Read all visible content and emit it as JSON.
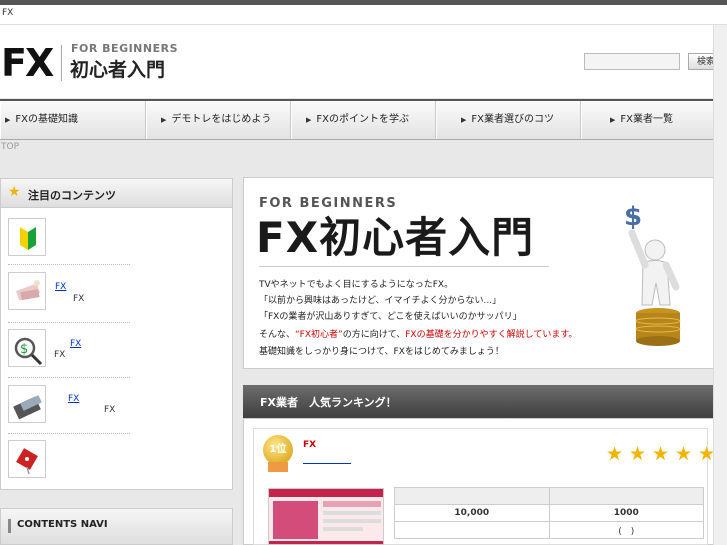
{
  "topbar": {
    "title": "FX"
  },
  "header": {
    "logo_fx": "FX",
    "logo_for_beginners": "FOR BEGINNERS",
    "logo_jp": "初心者入門",
    "search_placeholder": "",
    "search_button": "検索"
  },
  "nav": {
    "items": [
      {
        "label": "FXの基礎知識"
      },
      {
        "label": "デモトレをはじめよう"
      },
      {
        "label": "FXのポイントを学ぶ"
      },
      {
        "label": "FX業者選びのコツ"
      },
      {
        "label": "FX業者一覧"
      }
    ]
  },
  "breadcrumb": "TOP",
  "sidebar": {
    "heading": "注目のコンテンツ",
    "items": [
      {
        "link": "",
        "desc": ""
      },
      {
        "link": "FX",
        "desc": "FX"
      },
      {
        "link": "FX",
        "desc": "FX"
      },
      {
        "link": "FX",
        "desc": "FX"
      },
      {
        "link": "",
        "desc": ""
      }
    ],
    "navi_heading": "CONTENTS NAVI"
  },
  "hero": {
    "for_beginners": "FOR BEGINNERS",
    "title": "FX初心者入門",
    "line1": "TVやネットでもよく目にするようになったFX。",
    "line2": "「以前から興味はあったけど、イマイチよく分からない...」",
    "line3": "「FXの業者が沢山ありすぎて、どこを使えばいいのかサッパリ」",
    "line4_a": "そんな、",
    "line4_b": "“FX初心者”",
    "line4_c": "の方に向けて、",
    "line4_d": "FXの基礎を分かりやすく解説しています。",
    "line5": "基礎知識をしっかり身につけて、FXをはじめてみましょう！"
  },
  "ranking": {
    "heading": "FX業者　人気ランキング！",
    "rank_label": "1位",
    "name": "FX",
    "stars": "★",
    "rating": 5,
    "table": {
      "row1": [
        "",
        ""
      ],
      "row2": [
        "10,000",
        "1000"
      ],
      "row3": [
        "",
        "(　)"
      ]
    }
  },
  "colors": {
    "accent_red": "#cc0000",
    "link_blue": "#0033cc",
    "star_gold": "#f1b500",
    "nav_border": "#555555"
  }
}
